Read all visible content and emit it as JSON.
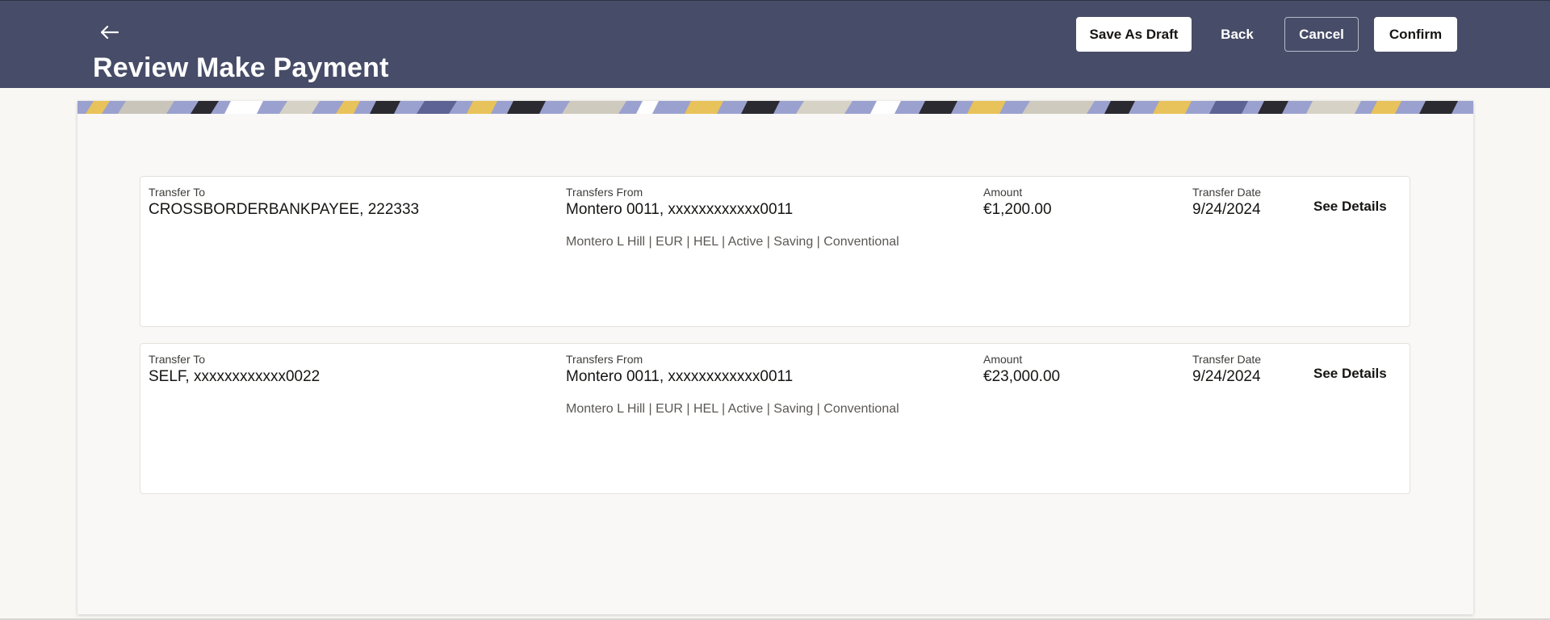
{
  "header": {
    "title": "Review Make Payment",
    "buttons": {
      "save_draft": "Save As Draft",
      "back": "Back",
      "cancel": "Cancel",
      "confirm": "Confirm"
    }
  },
  "transactions": [
    {
      "transfer_to_label": "Transfer To",
      "transfer_to": "CROSSBORDERBANKPAYEE, 222333",
      "from_label": "Transfers From",
      "from": "Montero 0011, xxxxxxxxxxxx0011",
      "from_info": "Montero L Hill | EUR | HEL | Active | Saving | Conventional",
      "amount_label": "Amount",
      "amount": "€1,200.00",
      "date_label": "Transfer Date",
      "date": "9/24/2024",
      "details_link": "See Details"
    },
    {
      "transfer_to_label": "Transfer To",
      "transfer_to": "SELF, xxxxxxxxxxxx0022",
      "from_label": "Transfers From",
      "from": "Montero 0011, xxxxxxxxxxxx0011",
      "from_info": "Montero L Hill | EUR | HEL | Active | Saving | Conventional",
      "amount_label": "Amount",
      "amount": "€23,000.00",
      "date_label": "Transfer Date",
      "date": "9/24/2024",
      "details_link": "See Details"
    }
  ],
  "colors": {
    "header_bg": "#474c68",
    "page_bg": "#f8f7f4",
    "card_bg": "#ffffff"
  },
  "icons": {
    "back": "arrow-left-icon"
  }
}
